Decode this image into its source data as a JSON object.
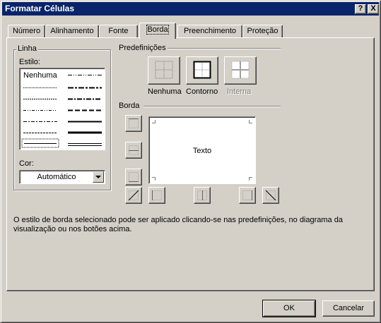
{
  "window": {
    "title": "Formatar Células",
    "help_label": "?",
    "close_label": "X"
  },
  "tabs": [
    {
      "label": "Número"
    },
    {
      "label": "Alinhamento"
    },
    {
      "label": "Fonte"
    },
    {
      "label": "Borda",
      "active": true
    },
    {
      "label": "Preenchimento"
    },
    {
      "label": "Proteção"
    }
  ],
  "linha": {
    "group_label": "Linha",
    "style_label": "Estilo:",
    "none_label": "Nenhuma",
    "color_label": "Cor:",
    "color_value": "Automático"
  },
  "presets": {
    "group_label": "Predefinições",
    "none_label": "Nenhuma",
    "outline_label": "Contorno",
    "inside_label": "Interna"
  },
  "border": {
    "group_label": "Borda",
    "preview_text": "Texto"
  },
  "hint_line1": "O estilo de borda selecionado pode ser aplicado clicando-se nas predefinições, no diagrama da",
  "hint_line2": "visualização ou nos botões acima.",
  "footer": {
    "ok_label": "OK",
    "cancel_label": "Cancelar"
  }
}
